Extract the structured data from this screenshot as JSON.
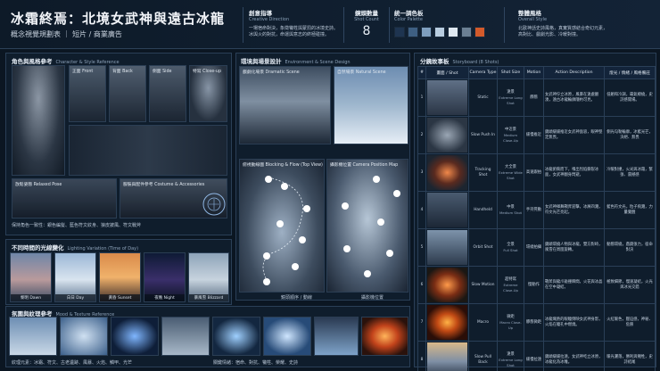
{
  "header": {
    "title": "冰霜終焉：北境女武神與遠古冰龍",
    "subtitle": "概念視覺規劃表 ｜ 短片 / 商業廣告",
    "creative": {
      "title": "創意指導",
      "subtitle": "Creative Direction",
      "text1": "一場宿命對決，象徵犧牲與蒙罰的冰境史詩。",
      "text2": "冰與火的對抗，命運與意志的終極碰撞。"
    },
    "shots": {
      "title": "鏡頭數量",
      "subtitle": "Shot Count",
      "value": "8"
    },
    "palette": {
      "title": "統一調色板",
      "subtitle": "Color Palette",
      "colors": [
        "#1e3450",
        "#3e5f82",
        "#7f9fbf",
        "#b9cde0",
        "#dfe8f1",
        "#6b7f93",
        "#d35a2b"
      ]
    },
    "style": {
      "title": "整體風格",
      "subtitle": "Overall Style",
      "text1": "北歐神話史詩風格，真實質感結合奇幻元素，",
      "text2": "高對比、戲劇光影、冷暖對撞。"
    }
  },
  "left": {
    "char": {
      "title": "角色與風格參考",
      "subtitle": "Character & Style Reference",
      "views": [
        "正面 Front",
        "背面 Back",
        "側面 Side",
        "特寫 Close-up"
      ],
      "relaxed": "放鬆姿態 Relaxed Pose",
      "costume": "服裝與配件參考 Costume & Accessories",
      "note": "保持角色一致性：銀色編髮、藍色符文紋身、狼皮披風、符文戰斧"
    },
    "light": {
      "title": "不同時間的光線變化",
      "subtitle": "Lighting Variation (Time of Day)",
      "items": [
        "黎明 Dawn",
        "白日 Day",
        "黃昏 Sunset",
        "夜晚 Night",
        "暴風雪 Blizzard"
      ]
    }
  },
  "mid": {
    "env": {
      "title": "環境與場景設計",
      "subtitle": "Environment & Scene Design",
      "dramatic": "戲劇化場景 Dramatic Scene",
      "natural": "自然場景 Natural Scene"
    },
    "blocking": {
      "title": "俯視動線圖 Blocking & Flow (Top View)",
      "legend": "鏡頭順序 / 動線"
    },
    "camera": {
      "title": "攝影機位置 Camera Position Map",
      "legend": "攝影機位置"
    }
  },
  "mood": {
    "title": "氛圍與紋理參考",
    "subtitle": "Mood & Texture Reference",
    "left_note": "紋理元素：冰霜、符文、古老遺跡、風暴、火焰、鱗甲、光芒",
    "right_note": "關鍵情緒：宿命、對抗、犧牲、榮耀、史詩"
  },
  "storyboard": {
    "title": "分鏡故事板",
    "subtitle": "Storyboard (8 Shots)",
    "headers": [
      "#",
      "畫面 / Shot",
      "Camera Type",
      "Shot Size",
      "Motion",
      "Action Description",
      "燈光 / 情緒 / 風格備註"
    ],
    "rows": [
      {
        "num": "1",
        "camera": "Static",
        "size": "遠景",
        "size_en": "Extreme Long Shot",
        "motion": "靜態",
        "action": "女武神佇立冰原，風暴在遠處翻湧，遠古冰龍輪廓隱約可見。",
        "notes": "低飽和冷調，霧氣繚繞，史詩感開場。"
      },
      {
        "num": "2",
        "camera": "Slow Push In",
        "size": "中近景",
        "size_en": "Medium Close-Up",
        "motion": "緩慢推近",
        "action": "鏡頭緩緩推近女武神面容，眼神堅定無畏。",
        "notes": "側光勾勒輪廓，冰藍光芒，決絕、無畏"
      },
      {
        "num": "3",
        "camera": "Tracking Shot",
        "size": "大全景",
        "size_en": "Extreme Wide Shot",
        "motion": "高速跟拍",
        "action": "冰龍俯衝而下，噴出烈焰撕裂冰面，女武神翻身閃避。",
        "notes": "冷暖對撞，火光與冰霜，緊張、震撼感"
      },
      {
        "num": "4",
        "camera": "Handheld",
        "size": "中景",
        "size_en": "Medium Shot",
        "motion": "手持晃動",
        "action": "女武神揮舞戰斧迎擊，冰屑四濺，符文光芒亮起。",
        "notes": "藍色符文光，粒子飛濺，力量覺醒"
      },
      {
        "num": "5",
        "camera": "Orbit Shot",
        "size": "全景",
        "size_en": "Full Shot",
        "motion": "環繞拍攝",
        "action": "鏡頭環繞人物與冰龍，雙方對峙，風雪在周圍旋轉。",
        "notes": "動態環繞，戲劇張力，宿命對決"
      },
      {
        "num": "6",
        "camera": "Slow Motion",
        "size": "超特寫",
        "size_en": "Extreme Close-Up",
        "motion": "慢動作",
        "action": "戰斧與龍爪碰撞瞬間，火花與冰晶在空中凝結。",
        "notes": "極致細節，慢速凝結，火光與冰光交錯"
      },
      {
        "num": "7",
        "camera": "Macro",
        "size": "微距",
        "size_en": "Macro Close-Up",
        "motion": "靜態微距",
        "action": "冰龍熾熱的眼瞳倒映女武神身影，火焰在瞳孔中燃燒。",
        "notes": "火紅暖色，壓迫感，神秘、危險"
      },
      {
        "num": "8",
        "camera": "Slow Pull Back",
        "size": "遠景",
        "size_en": "Extreme Long Shot",
        "motion": "緩慢拉遠",
        "action": "鏡頭緩緩拉遠，女武神屹立冰原，冰龍化為冰雕。",
        "notes": "暖光灑落，勝利與犧牲，史詩結尾"
      }
    ]
  }
}
